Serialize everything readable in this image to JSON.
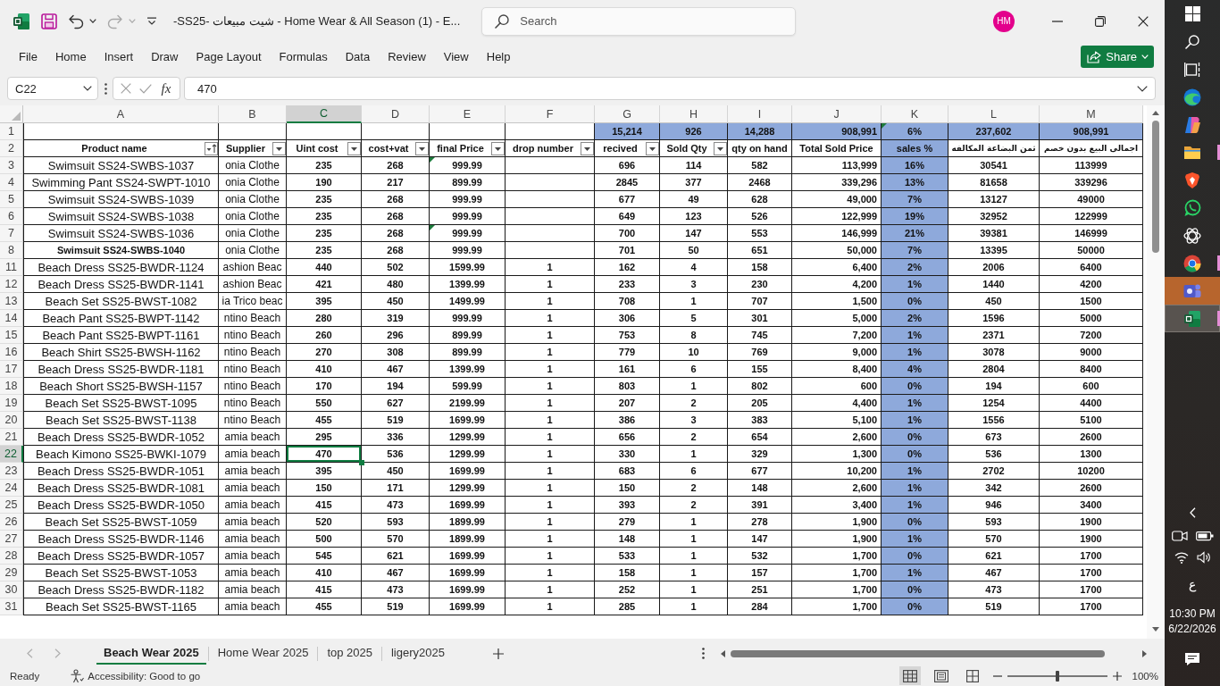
{
  "window": {
    "title": "-SS25- شيت مبيعات - Home Wear & All Season (1) - E...",
    "quick_access": [
      {
        "kind": "save",
        "disabled": false,
        "dropdown": false
      },
      {
        "kind": "undo",
        "disabled": false,
        "dropdown": true
      },
      {
        "kind": "redo",
        "disabled": true,
        "dropdown": true
      },
      {
        "kind": "customize",
        "disabled": false,
        "dropdown": false
      }
    ],
    "search": {
      "placeholder": "Search"
    },
    "account": {
      "initials": "HM"
    }
  },
  "ribbon": {
    "tabs": [
      "File",
      "Home",
      "Insert",
      "Draw",
      "Page Layout",
      "Formulas",
      "Data",
      "Review",
      "View",
      "Help"
    ],
    "share": "Share"
  },
  "formula_bar": {
    "name_box": "C22",
    "cancel": {
      "disabled": true
    },
    "enter": {
      "disabled": true
    },
    "function_label": "fx",
    "value": "470"
  },
  "grid": {
    "totals_row_number": "1",
    "header_row_number": "2",
    "columns": [
      {
        "letter": "A",
        "header": "Product name",
        "filter": true,
        "sorted": true,
        "selected": false,
        "shaded": false
      },
      {
        "letter": "B",
        "header": "Supplier",
        "filter": true,
        "sorted": false,
        "selected": false,
        "shaded": false
      },
      {
        "letter": "C",
        "header": "Uint cost",
        "filter": true,
        "sorted": false,
        "selected": true,
        "shaded": false
      },
      {
        "letter": "D",
        "header": "cost+vat",
        "filter": true,
        "sorted": false,
        "selected": false,
        "shaded": false
      },
      {
        "letter": "E",
        "header": "final Price",
        "filter": true,
        "sorted": false,
        "selected": false,
        "shaded": false
      },
      {
        "letter": "F",
        "header": "drop number",
        "filter": true,
        "sorted": false,
        "selected": false,
        "shaded": false
      },
      {
        "letter": "G",
        "header": "recived",
        "filter": true,
        "sorted": false,
        "selected": false,
        "shaded": false,
        "total": {
          "text": "15,214",
          "marked": false
        }
      },
      {
        "letter": "H",
        "header": "Sold Qty",
        "filter": true,
        "sorted": false,
        "selected": false,
        "shaded": false,
        "total": {
          "text": "926",
          "marked": false
        }
      },
      {
        "letter": "I",
        "header": "qty on hand",
        "filter": false,
        "sorted": false,
        "selected": false,
        "shaded": false,
        "total": {
          "text": "14,288",
          "marked": false
        }
      },
      {
        "letter": "J",
        "header": "Total Sold Price",
        "filter": false,
        "sorted": false,
        "selected": false,
        "shaded": false,
        "total": {
          "text": "908,991",
          "marked": false
        }
      },
      {
        "letter": "K",
        "header": "sales %",
        "filter": false,
        "sorted": false,
        "selected": false,
        "shaded": true,
        "total": {
          "text": "6%",
          "marked": true
        }
      },
      {
        "letter": "L",
        "header": "ثمن البضاعة المكالفه",
        "filter": false,
        "sorted": false,
        "selected": false,
        "shaded": false,
        "total": {
          "text": "237,602",
          "marked": false
        }
      },
      {
        "letter": "M",
        "header": "اجمالى البيع بدون خصم",
        "filter": false,
        "sorted": false,
        "selected": false,
        "shaded": false,
        "total": {
          "text": "908,991",
          "marked": false
        }
      }
    ],
    "rows": [
      {
        "number": "3",
        "selected": false,
        "bold": false,
        "price_flag": true,
        "product": "Swimsuit SS24-SWBS-1037",
        "supplier": "onia Clothe",
        "unit_cost": "235",
        "cost_vat": "268",
        "final_price": "999.99",
        "received": "696",
        "sold_qty": "114",
        "on_hand": "582",
        "total_sold": "113,999",
        "sales_pct": "16%",
        "goods_cost": "30541",
        "sales_total": "113999"
      },
      {
        "number": "4",
        "selected": false,
        "bold": false,
        "price_flag": false,
        "product": "Swimming Pant SS24-SWPT-1010",
        "supplier": "onia Clothe",
        "unit_cost": "190",
        "cost_vat": "217",
        "final_price": "899.99",
        "received": "2845",
        "sold_qty": "377",
        "on_hand": "2468",
        "total_sold": "339,296",
        "sales_pct": "13%",
        "goods_cost": "81658",
        "sales_total": "339296"
      },
      {
        "number": "5",
        "selected": false,
        "bold": false,
        "price_flag": false,
        "product": "Swimsuit SS24-SWBS-1039",
        "supplier": "onia Clothe",
        "unit_cost": "235",
        "cost_vat": "268",
        "final_price": "999.99",
        "received": "677",
        "sold_qty": "49",
        "on_hand": "628",
        "total_sold": "49,000",
        "sales_pct": "7%",
        "goods_cost": "13127",
        "sales_total": "49000"
      },
      {
        "number": "6",
        "selected": false,
        "bold": false,
        "price_flag": false,
        "product": "Swimsuit SS24-SWBS-1038",
        "supplier": "onia Clothe",
        "unit_cost": "235",
        "cost_vat": "268",
        "final_price": "999.99",
        "received": "649",
        "sold_qty": "123",
        "on_hand": "526",
        "total_sold": "122,999",
        "sales_pct": "19%",
        "goods_cost": "32952",
        "sales_total": "122999"
      },
      {
        "number": "7",
        "selected": false,
        "bold": false,
        "price_flag": true,
        "product": "Swimsuit SS24-SWBS-1036",
        "supplier": "onia Clothe",
        "unit_cost": "235",
        "cost_vat": "268",
        "final_price": "999.99",
        "received": "700",
        "sold_qty": "147",
        "on_hand": "553",
        "total_sold": "146,999",
        "sales_pct": "21%",
        "goods_cost": "39381",
        "sales_total": "146999"
      },
      {
        "number": "8",
        "selected": false,
        "bold": true,
        "price_flag": false,
        "product": "Swimsuit SS24-SWBS-1040",
        "supplier": "onia Clothe",
        "unit_cost": "235",
        "cost_vat": "268",
        "final_price": "999.99",
        "received": "701",
        "sold_qty": "50",
        "on_hand": "651",
        "total_sold": "50,000",
        "sales_pct": "7%",
        "goods_cost": "13395",
        "sales_total": "50000"
      },
      {
        "number": "11",
        "selected": false,
        "bold": false,
        "price_flag": false,
        "product": "Beach Dress SS25-BWDR-1124",
        "supplier": "ashion Beac",
        "unit_cost": "440",
        "cost_vat": "502",
        "final_price": "1599.99",
        "drop_number": "1",
        "received": "162",
        "sold_qty": "4",
        "on_hand": "158",
        "total_sold": "6,400",
        "sales_pct": "2%",
        "goods_cost": "2006",
        "sales_total": "6400"
      },
      {
        "number": "12",
        "selected": false,
        "bold": false,
        "price_flag": false,
        "product": "Beach Dress SS25-BWDR-1141",
        "supplier": "ashion Beac",
        "unit_cost": "421",
        "cost_vat": "480",
        "final_price": "1399.99",
        "drop_number": "1",
        "received": "233",
        "sold_qty": "3",
        "on_hand": "230",
        "total_sold": "4,200",
        "sales_pct": "1%",
        "goods_cost": "1440",
        "sales_total": "4200"
      },
      {
        "number": "13",
        "selected": false,
        "bold": false,
        "price_flag": false,
        "product": "Beach Set SS25-BWST-1082",
        "supplier": "ia Trico beac",
        "unit_cost": "395",
        "cost_vat": "450",
        "final_price": "1499.99",
        "drop_number": "1",
        "received": "708",
        "sold_qty": "1",
        "on_hand": "707",
        "total_sold": "1,500",
        "sales_pct": "0%",
        "goods_cost": "450",
        "sales_total": "1500"
      },
      {
        "number": "14",
        "selected": false,
        "bold": false,
        "price_flag": false,
        "product": "Beach Pant SS25-BWPT-1142",
        "supplier": "ntino Beach",
        "unit_cost": "280",
        "cost_vat": "319",
        "final_price": "999.99",
        "drop_number": "1",
        "received": "306",
        "sold_qty": "5",
        "on_hand": "301",
        "total_sold": "5,000",
        "sales_pct": "2%",
        "goods_cost": "1596",
        "sales_total": "5000"
      },
      {
        "number": "15",
        "selected": false,
        "bold": false,
        "price_flag": false,
        "product": "Beach Pant SS25-BWPT-1161",
        "supplier": "ntino Beach",
        "unit_cost": "260",
        "cost_vat": "296",
        "final_price": "899.99",
        "drop_number": "1",
        "received": "753",
        "sold_qty": "8",
        "on_hand": "745",
        "total_sold": "7,200",
        "sales_pct": "1%",
        "goods_cost": "2371",
        "sales_total": "7200"
      },
      {
        "number": "16",
        "selected": false,
        "bold": false,
        "price_flag": false,
        "product": "Beach Shirt SS25-BWSH-1162",
        "supplier": "ntino Beach",
        "unit_cost": "270",
        "cost_vat": "308",
        "final_price": "899.99",
        "drop_number": "1",
        "received": "779",
        "sold_qty": "10",
        "on_hand": "769",
        "total_sold": "9,000",
        "sales_pct": "1%",
        "goods_cost": "3078",
        "sales_total": "9000"
      },
      {
        "number": "17",
        "selected": false,
        "bold": false,
        "price_flag": false,
        "product": "Beach Dress SS25-BWDR-1181",
        "supplier": "ntino Beach",
        "unit_cost": "410",
        "cost_vat": "467",
        "final_price": "1399.99",
        "drop_number": "1",
        "received": "161",
        "sold_qty": "6",
        "on_hand": "155",
        "total_sold": "8,400",
        "sales_pct": "4%",
        "goods_cost": "2804",
        "sales_total": "8400"
      },
      {
        "number": "18",
        "selected": false,
        "bold": false,
        "price_flag": false,
        "product": "Beach Short SS25-BWSH-1157",
        "supplier": "ntino Beach",
        "unit_cost": "170",
        "cost_vat": "194",
        "final_price": "599.99",
        "drop_number": "1",
        "received": "803",
        "sold_qty": "1",
        "on_hand": "802",
        "total_sold": "600",
        "sales_pct": "0%",
        "goods_cost": "194",
        "sales_total": "600"
      },
      {
        "number": "19",
        "selected": false,
        "bold": false,
        "price_flag": false,
        "product": "Beach Set SS25-BWST-1095",
        "supplier": "ntino Beach",
        "unit_cost": "550",
        "cost_vat": "627",
        "final_price": "2199.99",
        "drop_number": "1",
        "received": "207",
        "sold_qty": "2",
        "on_hand": "205",
        "total_sold": "4,400",
        "sales_pct": "1%",
        "goods_cost": "1254",
        "sales_total": "4400"
      },
      {
        "number": "20",
        "selected": false,
        "bold": false,
        "price_flag": false,
        "product": "Beach Set SS25-BWST-1138",
        "supplier": "ntino Beach",
        "unit_cost": "455",
        "cost_vat": "519",
        "final_price": "1699.99",
        "drop_number": "1",
        "received": "386",
        "sold_qty": "3",
        "on_hand": "383",
        "total_sold": "5,100",
        "sales_pct": "1%",
        "goods_cost": "1556",
        "sales_total": "5100"
      },
      {
        "number": "21",
        "selected": false,
        "bold": false,
        "price_flag": false,
        "product": "Beach Dress SS25-BWDR-1052",
        "supplier": "amia beach",
        "unit_cost": "295",
        "cost_vat": "336",
        "final_price": "1299.99",
        "drop_number": "1",
        "received": "656",
        "sold_qty": "2",
        "on_hand": "654",
        "total_sold": "2,600",
        "sales_pct": "0%",
        "goods_cost": "673",
        "sales_total": "2600"
      },
      {
        "number": "22",
        "selected": true,
        "bold": false,
        "price_flag": false,
        "product": "Beach Kimono SS25-BWKI-1079",
        "supplier": "amia beach",
        "unit_cost": "470",
        "cost_vat": "536",
        "final_price": "1299.99",
        "drop_number": "1",
        "received": "330",
        "sold_qty": "1",
        "on_hand": "329",
        "total_sold": "1,300",
        "sales_pct": "0%",
        "goods_cost": "536",
        "sales_total": "1300"
      },
      {
        "number": "23",
        "selected": false,
        "bold": false,
        "price_flag": false,
        "product": "Beach Dress SS25-BWDR-1051",
        "supplier": "amia beach",
        "unit_cost": "395",
        "cost_vat": "450",
        "final_price": "1699.99",
        "drop_number": "1",
        "received": "683",
        "sold_qty": "6",
        "on_hand": "677",
        "total_sold": "10,200",
        "sales_pct": "1%",
        "goods_cost": "2702",
        "sales_total": "10200"
      },
      {
        "number": "24",
        "selected": false,
        "bold": false,
        "price_flag": false,
        "product": "Beach Dress SS25-BWDR-1081",
        "supplier": "amia beach",
        "unit_cost": "150",
        "cost_vat": "171",
        "final_price": "1299.99",
        "drop_number": "1",
        "received": "150",
        "sold_qty": "2",
        "on_hand": "148",
        "total_sold": "2,600",
        "sales_pct": "1%",
        "goods_cost": "342",
        "sales_total": "2600"
      },
      {
        "number": "25",
        "selected": false,
        "bold": false,
        "price_flag": false,
        "product": "Beach Dress SS25-BWDR-1050",
        "supplier": "amia beach",
        "unit_cost": "415",
        "cost_vat": "473",
        "final_price": "1699.99",
        "drop_number": "1",
        "received": "393",
        "sold_qty": "2",
        "on_hand": "391",
        "total_sold": "3,400",
        "sales_pct": "1%",
        "goods_cost": "946",
        "sales_total": "3400"
      },
      {
        "number": "26",
        "selected": false,
        "bold": false,
        "price_flag": false,
        "product": "Beach Set SS25-BWST-1059",
        "supplier": "amia beach",
        "unit_cost": "520",
        "cost_vat": "593",
        "final_price": "1899.99",
        "drop_number": "1",
        "received": "279",
        "sold_qty": "1",
        "on_hand": "278",
        "total_sold": "1,900",
        "sales_pct": "0%",
        "goods_cost": "593",
        "sales_total": "1900"
      },
      {
        "number": "27",
        "selected": false,
        "bold": false,
        "price_flag": false,
        "product": "Beach Dress SS25-BWDR-1146",
        "supplier": "amia beach",
        "unit_cost": "500",
        "cost_vat": "570",
        "final_price": "1899.99",
        "drop_number": "1",
        "received": "148",
        "sold_qty": "1",
        "on_hand": "147",
        "total_sold": "1,900",
        "sales_pct": "1%",
        "goods_cost": "570",
        "sales_total": "1900"
      },
      {
        "number": "28",
        "selected": false,
        "bold": false,
        "price_flag": false,
        "product": "Beach Dress SS25-BWDR-1057",
        "supplier": "amia beach",
        "unit_cost": "545",
        "cost_vat": "621",
        "final_price": "1699.99",
        "drop_number": "1",
        "received": "533",
        "sold_qty": "1",
        "on_hand": "532",
        "total_sold": "1,700",
        "sales_pct": "0%",
        "goods_cost": "621",
        "sales_total": "1700"
      },
      {
        "number": "29",
        "selected": false,
        "bold": false,
        "price_flag": false,
        "product": "Beach Set SS25-BWST-1053",
        "supplier": "amia beach",
        "unit_cost": "410",
        "cost_vat": "467",
        "final_price": "1699.99",
        "drop_number": "1",
        "received": "158",
        "sold_qty": "1",
        "on_hand": "157",
        "total_sold": "1,700",
        "sales_pct": "1%",
        "goods_cost": "467",
        "sales_total": "1700"
      },
      {
        "number": "30",
        "selected": false,
        "bold": false,
        "price_flag": false,
        "product": "Beach Dress SS25-BWDR-1182",
        "supplier": "amia beach",
        "unit_cost": "415",
        "cost_vat": "473",
        "final_price": "1699.99",
        "drop_number": "1",
        "received": "252",
        "sold_qty": "1",
        "on_hand": "251",
        "total_sold": "1,700",
        "sales_pct": "0%",
        "goods_cost": "473",
        "sales_total": "1700"
      },
      {
        "number": "31",
        "selected": false,
        "bold": false,
        "price_flag": false,
        "product": "Beach Set SS25-BWST-1165",
        "supplier": "amia beach",
        "unit_cost": "455",
        "cost_vat": "519",
        "final_price": "1699.99",
        "drop_number": "1",
        "received": "285",
        "sold_qty": "1",
        "on_hand": "284",
        "total_sold": "1,700",
        "sales_pct": "0%",
        "goods_cost": "519",
        "sales_total": "1700"
      }
    ]
  },
  "sheet_tabs": {
    "nav_disabled": true,
    "tabs": [
      {
        "label": "Beach Wear 2025",
        "selected": true
      },
      {
        "label": "Home Wear 2025",
        "selected": false
      },
      {
        "label": "top 2025",
        "selected": false
      },
      {
        "label": "ligery2025",
        "selected": false
      }
    ]
  },
  "status_bar": {
    "status": "Ready",
    "accessibility": "Accessibility: Good to go",
    "views": [
      {
        "kind": "normal",
        "selected": true
      },
      {
        "kind": "page_layout",
        "selected": false
      },
      {
        "kind": "page_break",
        "selected": false
      }
    ],
    "zoom": {
      "level": 0.5,
      "reading": "100%"
    }
  },
  "taskbar": {
    "apps": [
      {
        "kind": "swirl",
        "selected": false,
        "attention": false,
        "running": false
      },
      {
        "kind": "ribbon",
        "selected": false,
        "attention": false,
        "running": false
      },
      {
        "kind": "folder",
        "selected": false,
        "attention": false,
        "running": true
      },
      {
        "kind": "shield",
        "selected": false,
        "attention": false,
        "running": false
      },
      {
        "kind": "bubble",
        "selected": false,
        "attention": false,
        "running": false
      },
      {
        "kind": "knot",
        "selected": false,
        "attention": false,
        "running": false
      },
      {
        "kind": "ring",
        "selected": false,
        "attention": false,
        "running": true
      },
      {
        "kind": "tile",
        "selected": false,
        "attention": true,
        "running": false
      },
      {
        "kind": "sheet",
        "selected": true,
        "attention": false,
        "running": true
      }
    ],
    "language": "ع",
    "time": "10:30 PM",
    "date": "6/22/2026"
  }
}
